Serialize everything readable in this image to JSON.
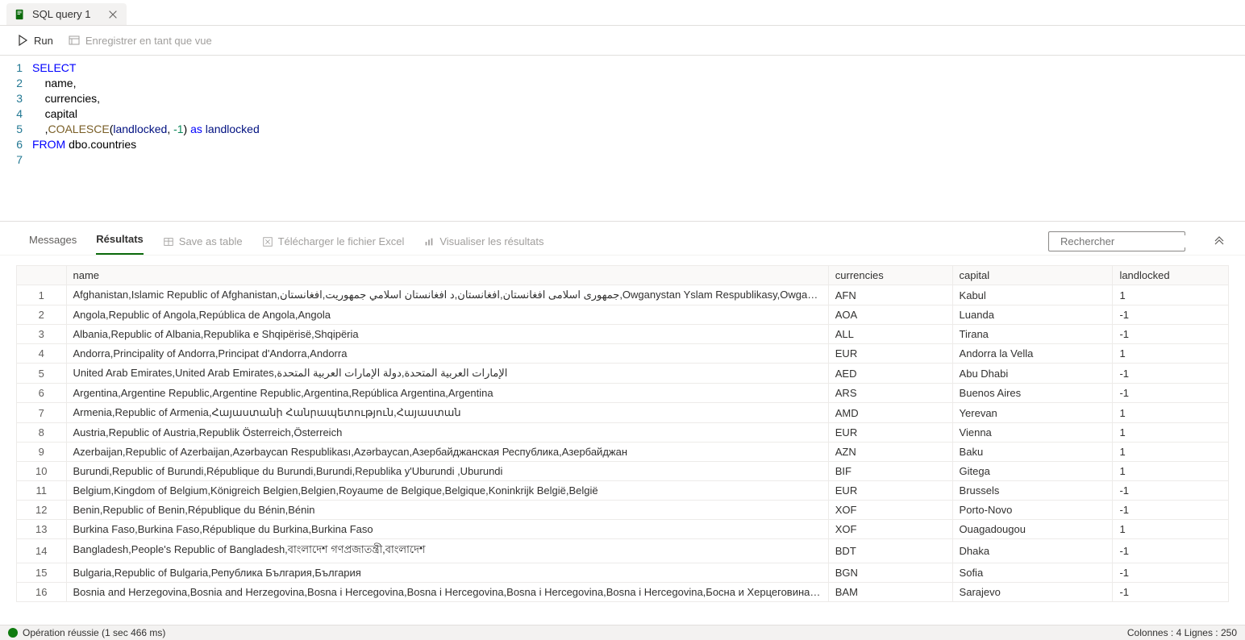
{
  "tab": {
    "label": "SQL query 1"
  },
  "toolbar": {
    "run": "Run",
    "save_as_view": "Enregistrer en tant que vue"
  },
  "editor": {
    "lines": [
      "1",
      "2",
      "3",
      "4",
      "5",
      "6",
      "7"
    ],
    "tokens": {
      "select": "SELECT",
      "name": "name,",
      "currencies": "currencies,",
      "capital": "capital",
      "comma": ",",
      "coalesce": "COALESCE",
      "paren_open": "(",
      "landlocked_id": "landlocked",
      "sep": ", ",
      "neg1": "-1",
      "paren_close": ")",
      "as": " as ",
      "alias": "landlocked",
      "from": "FROM",
      "table": " dbo.countries"
    }
  },
  "results_tabs": {
    "messages": "Messages",
    "results": "Résultats",
    "save_as_table": "Save as table",
    "download_excel": "Télécharger le fichier Excel",
    "visualize": "Visualiser les résultats",
    "search_placeholder": "Rechercher"
  },
  "columns": {
    "name": "name",
    "currencies": "currencies",
    "capital": "capital",
    "landlocked": "landlocked"
  },
  "rows": [
    {
      "n": "1",
      "name": "Afghanistan,Islamic Republic of Afghanistan,جمهوری اسلامی افغانستان,افغانستان,د افغانستان اسلامي جمهوریت,افغانستان,Owganystan Yslam Respublikasy,Owganystan",
      "curr": "AFN",
      "cap": "Kabul",
      "ll": "1"
    },
    {
      "n": "2",
      "name": "Angola,Republic of Angola,República de Angola,Angola",
      "curr": "AOA",
      "cap": "Luanda",
      "ll": "-1"
    },
    {
      "n": "3",
      "name": "Albania,Republic of Albania,Republika e Shqipërisë,Shqipëria",
      "curr": "ALL",
      "cap": "Tirana",
      "ll": "-1"
    },
    {
      "n": "4",
      "name": "Andorra,Principality of Andorra,Principat d'Andorra,Andorra",
      "curr": "EUR",
      "cap": "Andorra la Vella",
      "ll": "1"
    },
    {
      "n": "5",
      "name": "United Arab Emirates,United Arab Emirates,الإمارات العربية المتحدة,دولة الإمارات العربية المتحدة",
      "curr": "AED",
      "cap": "Abu Dhabi",
      "ll": "-1"
    },
    {
      "n": "6",
      "name": "Argentina,Argentine Republic,Argentine Republic,Argentina,República Argentina,Argentina",
      "curr": "ARS",
      "cap": "Buenos Aires",
      "ll": "-1"
    },
    {
      "n": "7",
      "name": "Armenia,Republic of Armenia,Հայաստանի Հանրապետություն,Հայաստան",
      "curr": "AMD",
      "cap": "Yerevan",
      "ll": "1"
    },
    {
      "n": "8",
      "name": "Austria,Republic of Austria,Republik Österreich,Österreich",
      "curr": "EUR",
      "cap": "Vienna",
      "ll": "1"
    },
    {
      "n": "9",
      "name": "Azerbaijan,Republic of Azerbaijan,Azərbaycan Respublikası,Azərbaycan,Азербайджанская Республика,Азербайджан",
      "curr": "AZN",
      "cap": "Baku",
      "ll": "1"
    },
    {
      "n": "10",
      "name": "Burundi,Republic of Burundi,République du Burundi,Burundi,Republika y'Uburundi ,Uburundi",
      "curr": "BIF",
      "cap": "Gitega",
      "ll": "1"
    },
    {
      "n": "11",
      "name": "Belgium,Kingdom of Belgium,Königreich Belgien,Belgien,Royaume de Belgique,Belgique,Koninkrijk België,België",
      "curr": "EUR",
      "cap": "Brussels",
      "ll": "-1"
    },
    {
      "n": "12",
      "name": "Benin,Republic of Benin,République du Bénin,Bénin",
      "curr": "XOF",
      "cap": "Porto-Novo",
      "ll": "-1"
    },
    {
      "n": "13",
      "name": "Burkina Faso,Burkina Faso,République du Burkina,Burkina Faso",
      "curr": "XOF",
      "cap": "Ouagadougou",
      "ll": "1"
    },
    {
      "n": "14",
      "name": "Bangladesh,People's Republic of Bangladesh,বাংলাদেশ গণপ্রজাতন্ত্রী,বাংলাদেশ",
      "curr": "BDT",
      "cap": "Dhaka",
      "ll": "-1"
    },
    {
      "n": "15",
      "name": "Bulgaria,Republic of Bulgaria,Република България,България",
      "curr": "BGN",
      "cap": "Sofia",
      "ll": "-1"
    },
    {
      "n": "16",
      "name": "Bosnia and Herzegovina,Bosnia and Herzegovina,Bosna i Hercegovina,Bosna i Hercegovina,Bosna i Hercegovina,Bosna i Hercegovina,Босна и Херцеговина,Босна и Херцег...",
      "curr": "BAM",
      "cap": "Sarajevo",
      "ll": "-1"
    }
  ],
  "status": {
    "message": "Opération réussie (1 sec 466 ms)",
    "right": "Colonnes : 4  Lignes : 250"
  }
}
